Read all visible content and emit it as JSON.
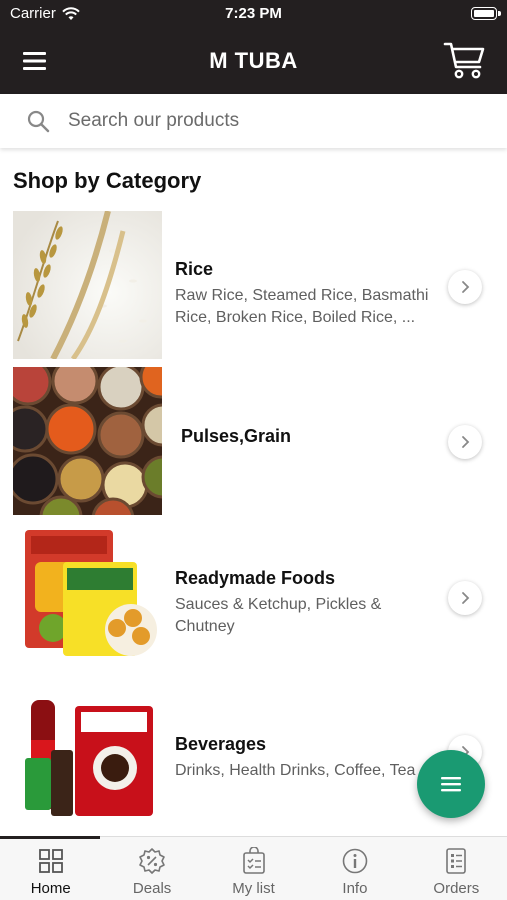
{
  "status_bar": {
    "carrier": "Carrier",
    "time": "7:23 PM"
  },
  "header": {
    "title": "M TUBA",
    "menu_icon": "hamburger-menu-icon",
    "cart_icon": "shopping-cart-icon"
  },
  "search": {
    "placeholder": "Search our products",
    "icon": "search-icon"
  },
  "section_title": "Shop by Category",
  "categories": [
    {
      "name": "Rice",
      "description": "Raw Rice, Steamed Rice, Basmathi Rice, Broken Rice, Boiled Rice, ..."
    },
    {
      "name": "Pulses,Grain",
      "description": ""
    },
    {
      "name": "Readymade Foods",
      "description": "Sauces & Ketchup, Pickles & Chutney"
    },
    {
      "name": "Beverages",
      "description": "Drinks, Health Drinks, Coffee, Tea"
    }
  ],
  "fab_icon": "menu-lines-icon",
  "tabs": [
    {
      "label": "Home",
      "icon": "grid-icon",
      "active": true
    },
    {
      "label": "Deals",
      "icon": "badge-percent-icon",
      "active": false
    },
    {
      "label": "My list",
      "icon": "shopping-list-icon",
      "active": false
    },
    {
      "label": "Info",
      "icon": "info-icon",
      "active": false
    },
    {
      "label": "Orders",
      "icon": "orders-icon",
      "active": false
    }
  ],
  "colors": {
    "header_bg": "#231f20",
    "fab": "#1a9a72",
    "text_muted": "#5f5f5f"
  }
}
